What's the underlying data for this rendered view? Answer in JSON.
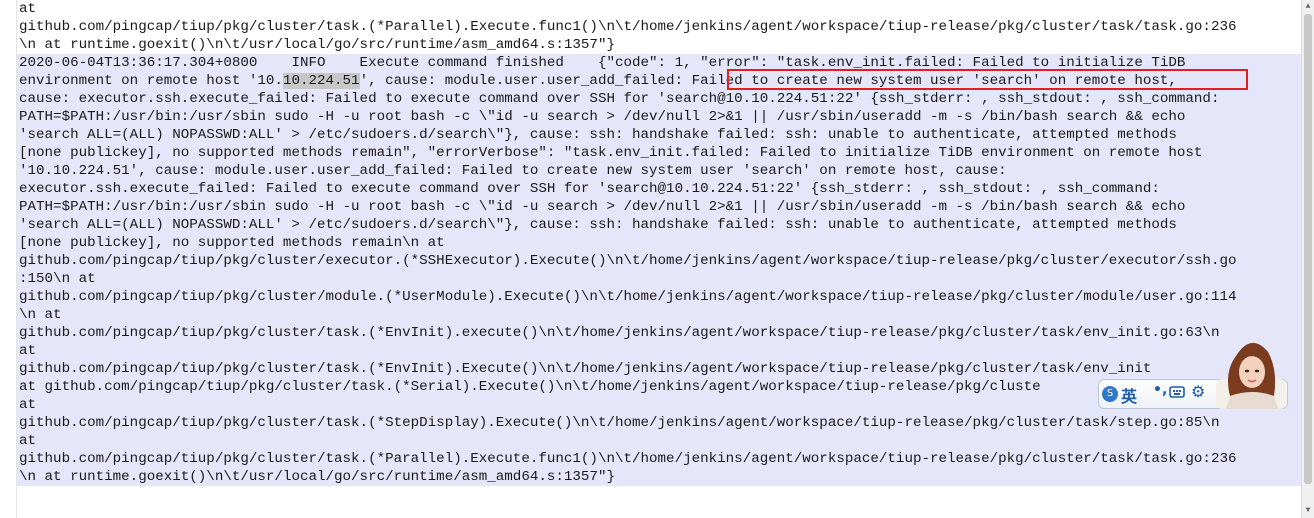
{
  "editor": {
    "lines": [
      {
        "text": "at",
        "selected": false
      },
      {
        "text": "github.com/pingcap/tiup/pkg/cluster/task.(*Parallel).Execute.func1()\\n\\t/home/jenkins/agent/workspace/tiup-release/pkg/cluster/task/task.go:236",
        "selected": false
      },
      {
        "text": "\\n at runtime.goexit()\\n\\t/usr/local/go/src/runtime/asm_amd64.s:1357\"}",
        "selected": false
      },
      {
        "text": "2020-06-04T13:36:17.304+0800    INFO    Execute command finished    {\"code\": 1, \"error\": \"task.env_init.failed: Failed to initialize TiDB",
        "selected": true
      },
      {
        "pre": "environment on remote host '10.",
        "hl": "10.224.51",
        "post": "', cause: module.user.user_add_failed: Failed to create new system user 'search' on remote host,",
        "selected": true
      },
      {
        "text": "cause: executor.ssh.execute_failed: Failed to execute command over SSH for 'search@10.10.224.51:22' {ssh_stderr: , ssh_stdout: , ssh_command:",
        "selected": true
      },
      {
        "text": "PATH=$PATH:/usr/bin:/usr/sbin sudo -H -u root bash -c \\\"id -u search > /dev/null 2>&1 || /usr/sbin/useradd -m -s /bin/bash search && echo",
        "selected": true
      },
      {
        "text": "'search ALL=(ALL) NOPASSWD:ALL' > /etc/sudoers.d/search\\\"}, cause: ssh: handshake failed: ssh: unable to authenticate, attempted methods",
        "selected": true
      },
      {
        "text": "[none publickey], no supported methods remain\", \"errorVerbose\": \"task.env_init.failed: Failed to initialize TiDB environment on remote host",
        "selected": true
      },
      {
        "text": "'10.10.224.51', cause: module.user.user_add_failed: Failed to create new system user 'search' on remote host, cause:",
        "selected": true
      },
      {
        "text": "executor.ssh.execute_failed: Failed to execute command over SSH for 'search@10.10.224.51:22' {ssh_stderr: , ssh_stdout: , ssh_command:",
        "selected": true
      },
      {
        "text": "PATH=$PATH:/usr/bin:/usr/sbin sudo -H -u root bash -c \\\"id -u search > /dev/null 2>&1 || /usr/sbin/useradd -m -s /bin/bash search && echo",
        "selected": true
      },
      {
        "text": "'search ALL=(ALL) NOPASSWD:ALL' > /etc/sudoers.d/search\\\"}, cause: ssh: handshake failed: ssh: unable to authenticate, attempted methods",
        "selected": true
      },
      {
        "text": "[none publickey], no supported methods remain\\n at",
        "selected": true
      },
      {
        "text": "github.com/pingcap/tiup/pkg/cluster/executor.(*SSHExecutor).Execute()\\n\\t/home/jenkins/agent/workspace/tiup-release/pkg/cluster/executor/ssh.go",
        "selected": true
      },
      {
        "text": ":150\\n at",
        "selected": true
      },
      {
        "text": "github.com/pingcap/tiup/pkg/cluster/module.(*UserModule).Execute()\\n\\t/home/jenkins/agent/workspace/tiup-release/pkg/cluster/module/user.go:114",
        "selected": true
      },
      {
        "text": "\\n at",
        "selected": true
      },
      {
        "text": "github.com/pingcap/tiup/pkg/cluster/task.(*EnvInit).execute()\\n\\t/home/jenkins/agent/workspace/tiup-release/pkg/cluster/task/env_init.go:63\\n",
        "selected": true
      },
      {
        "text": "at",
        "selected": true
      },
      {
        "text": "github.com/pingcap/tiup/pkg/cluster/task.(*EnvInit).Execute()\\n\\t/home/jenkins/agent/workspace/tiup-release/pkg/cluster/task/env_init",
        "selected": true
      },
      {
        "text": "at github.com/pingcap/tiup/pkg/cluster/task.(*Serial).Execute()\\n\\t/home/jenkins/agent/workspace/tiup-release/pkg/cluste",
        "selected": true
      },
      {
        "text": "at",
        "selected": true
      },
      {
        "text": "github.com/pingcap/tiup/pkg/cluster/task.(*StepDisplay).Execute()\\n\\t/home/jenkins/agent/workspace/tiup-release/pkg/cluster/task/step.go:85\\n",
        "selected": true
      },
      {
        "text": "at",
        "selected": true
      },
      {
        "text": "github.com/pingcap/tiup/pkg/cluster/task.(*Parallel).Execute.func1()\\n\\t/home/jenkins/agent/workspace/tiup-release/pkg/cluster/task/task.go:236",
        "selected": true
      },
      {
        "text": "\\n at runtime.goexit()\\n\\t/usr/local/go/src/runtime/asm_amd64.s:1357\"}",
        "selected": true
      }
    ]
  },
  "ime_toolbar": {
    "language": "英",
    "logo": "S",
    "punctuation": "•,",
    "icons": [
      "keyboard-icon",
      "gear-icon",
      "skin-avatar"
    ]
  },
  "colors": {
    "selection": "#e6e6fa",
    "highlight_box": "#e0201e",
    "ime_blue": "#1f5da8"
  }
}
